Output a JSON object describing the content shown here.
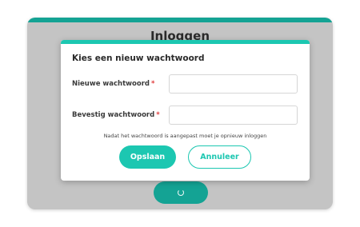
{
  "colors": {
    "accent": "#1cc7b1",
    "accent_dark": "#14a394",
    "required": "#e03c3c"
  },
  "login": {
    "title": "Inloggen",
    "spinner_icon": "loading-spinner-icon"
  },
  "dialog": {
    "title": "Kies een nieuw wachtwoord",
    "new_password_label": "Nieuwe wachtwoord",
    "confirm_password_label": "Bevestig wachtwoord",
    "required_mark": "*",
    "new_password_value": "",
    "confirm_password_value": "",
    "note": "Nadat het wachtwoord is aangepast moet je opnieuw inloggen",
    "save_label": "Opslaan",
    "cancel_label": "Annuleer"
  }
}
